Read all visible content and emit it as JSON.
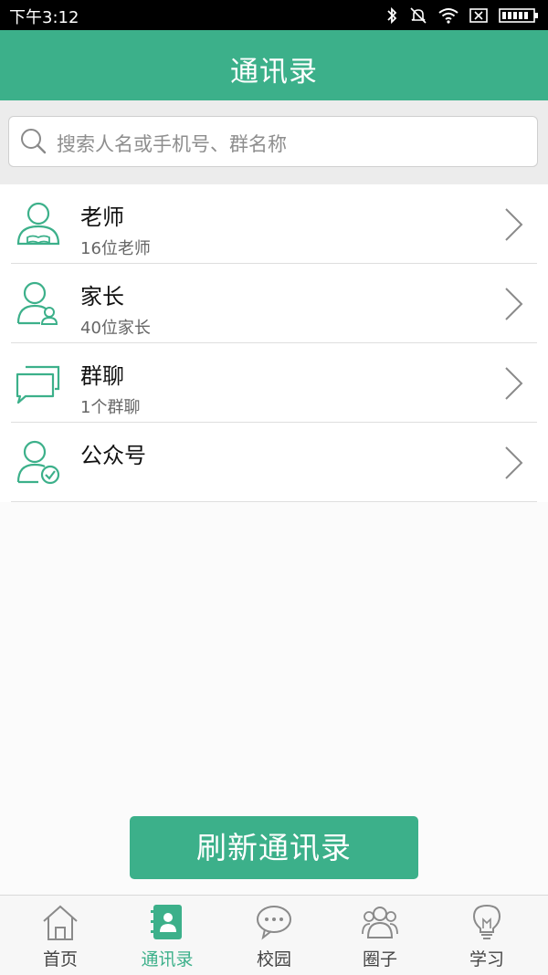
{
  "status_bar": {
    "time": "下午3:12",
    "icons": [
      "bluetooth-icon",
      "mute-icon",
      "wifi-icon",
      "sim-icon",
      "battery-icon"
    ]
  },
  "header": {
    "title": "通讯录"
  },
  "search": {
    "placeholder": "搜索人名或手机号、群名称"
  },
  "contacts": [
    {
      "title": "老师",
      "subtitle": "16位老师",
      "icon": "teacher-icon"
    },
    {
      "title": "家长",
      "subtitle": "40位家长",
      "icon": "parent-icon"
    },
    {
      "title": "群聊",
      "subtitle": "1个群聊",
      "icon": "group-chat-icon"
    },
    {
      "title": "公众号",
      "subtitle": "",
      "icon": "public-account-icon"
    }
  ],
  "refresh_button": {
    "label": "刷新通讯录"
  },
  "tabs": [
    {
      "label": "首页",
      "icon": "home-icon",
      "active": false
    },
    {
      "label": "通讯录",
      "icon": "contacts-icon",
      "active": true
    },
    {
      "label": "校园",
      "icon": "chat-bubble-icon",
      "active": false
    },
    {
      "label": "圈子",
      "icon": "people-icon",
      "active": false
    },
    {
      "label": "学习",
      "icon": "lightbulb-icon",
      "active": false
    }
  ],
  "colors": {
    "accent": "#3cb08a",
    "status_bar": "#000000",
    "background": "#fbfbfb"
  }
}
